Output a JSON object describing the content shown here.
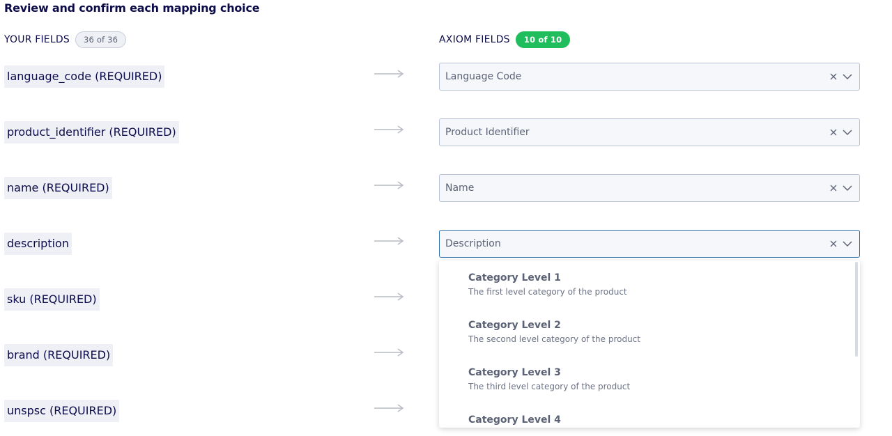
{
  "heading": "Review and confirm each mapping choice",
  "your_fields": {
    "label": "YOUR FIELDS",
    "count": "36 of 36"
  },
  "axiom_fields": {
    "label": "AXIOM FIELDS",
    "count": "10 of 10"
  },
  "rows": [
    {
      "field": "language_code (REQUIRED)",
      "mapped": "Language Code"
    },
    {
      "field": "product_identifier (REQUIRED)",
      "mapped": "Product Identifier"
    },
    {
      "field": "name (REQUIRED)",
      "mapped": "Name"
    },
    {
      "field": "description",
      "mapped": "Description"
    },
    {
      "field": "sku (REQUIRED)",
      "mapped": ""
    },
    {
      "field": "brand (REQUIRED)",
      "mapped": ""
    },
    {
      "field": "unspsc (REQUIRED)",
      "mapped": ""
    }
  ],
  "dropdown": {
    "options": [
      {
        "title": "Category Level 1",
        "description": "The first level category of the product"
      },
      {
        "title": "Category Level 2",
        "description": "The second level category of the product"
      },
      {
        "title": "Category Level 3",
        "description": "The third level category of the product"
      },
      {
        "title": "Category Level 4",
        "description": ""
      }
    ]
  },
  "icons": {
    "clear": "close-icon",
    "expand": "chevron-down-icon",
    "mapping": "arrow-right-icon"
  },
  "colors": {
    "accent_green": "#1fbd5c",
    "text_primary": "#0d0c4a",
    "focus_border": "#2c6fa8"
  }
}
